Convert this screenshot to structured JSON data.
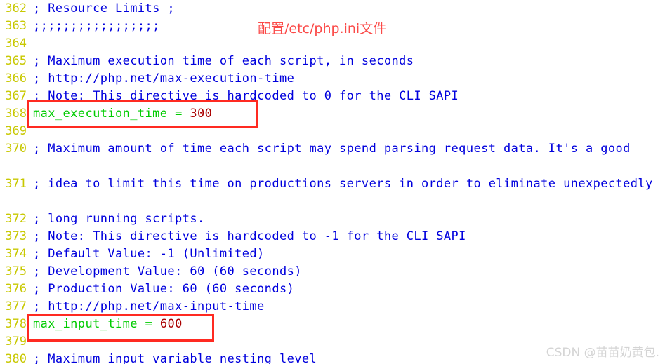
{
  "editor": {
    "background_color": "#ffffff",
    "gutter_color": "#c8c800",
    "comment_color": "#0000dd",
    "key_color": "#00cc00",
    "value_color": "#aa0000",
    "highlight_color": "#ff2a21",
    "watermark_color": "#d4d4d4",
    "lines": [
      {
        "number": "362",
        "kind": "comment",
        "text": "; Resource Limits ;"
      },
      {
        "number": "363",
        "kind": "comment",
        "text": ";;;;;;;;;;;;;;;;;"
      },
      {
        "number": "364",
        "kind": "blank",
        "text": ""
      },
      {
        "number": "365",
        "kind": "comment",
        "text": "; Maximum execution time of each script, in seconds"
      },
      {
        "number": "366",
        "kind": "comment",
        "text": "; http://php.net/max-execution-time"
      },
      {
        "number": "367",
        "kind": "comment",
        "text": "; Note: This directive is hardcoded to 0 for the CLI SAPI"
      },
      {
        "number": "368",
        "kind": "setting",
        "key": "max_execution_time",
        "eq": "=",
        "value": "300"
      },
      {
        "number": "369",
        "kind": "blank",
        "text": ""
      },
      {
        "number": "370",
        "kind": "comment-wrapped",
        "text": "; Maximum amount of time each script may spend parsing request data. It's a good"
      },
      {
        "number": "371",
        "kind": "comment-wrapped",
        "text": "; idea to limit this time on productions servers in order to eliminate unexpectedly"
      },
      {
        "number": "372",
        "kind": "comment",
        "text": "; long running scripts."
      },
      {
        "number": "373",
        "kind": "comment",
        "text": "; Note: This directive is hardcoded to -1 for the CLI SAPI"
      },
      {
        "number": "374",
        "kind": "comment",
        "text": "; Default Value: -1 (Unlimited)"
      },
      {
        "number": "375",
        "kind": "comment",
        "text": "; Development Value: 60 (60 seconds)"
      },
      {
        "number": "376",
        "kind": "comment",
        "text": "; Production Value: 60 (60 seconds)"
      },
      {
        "number": "377",
        "kind": "comment",
        "text": "; http://php.net/max-input-time"
      },
      {
        "number": "378",
        "kind": "setting",
        "key": "max_input_time",
        "eq": "=",
        "value": "600"
      },
      {
        "number": "379",
        "kind": "blank",
        "text": ""
      },
      {
        "number": "380",
        "kind": "comment",
        "text": "; Maximum input variable nesting level"
      }
    ]
  },
  "annotation": {
    "text": "配置/etc/php.ini文件"
  },
  "watermark": {
    "text": "CSDN @苗苗奶黄包."
  }
}
